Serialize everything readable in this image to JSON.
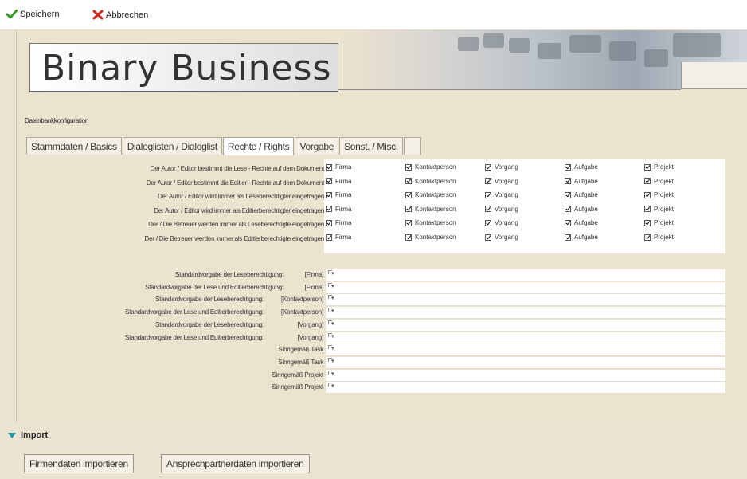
{
  "toolbar": {
    "save_label": "Speichern",
    "cancel_label": "Abbrechen"
  },
  "branding": {
    "logo_text": "Binary Business"
  },
  "section_label": "Datenbankkonfiguration",
  "tabs": [
    {
      "label": "Stammdaten / Basics",
      "active": false
    },
    {
      "label": "Dialoglisten / Dialoglist",
      "active": false
    },
    {
      "label": "Rechte / Rights",
      "active": true
    },
    {
      "label": "Vorgabe",
      "active": false
    },
    {
      "label": "Sonst. / Misc.",
      "active": false
    },
    {
      "label": "",
      "active": false
    }
  ],
  "rights_rows": [
    {
      "label": "Der Autor / Editor bestimmt die Lese - Rechte auf dem Dokument",
      "checks": [
        "Firma",
        "Kontaktperson",
        "Vorgang",
        "Aufgabe",
        "Projekt"
      ]
    },
    {
      "label": "Der Autor / Editor bestimmt die Editier - Rechte auf dem Dokument",
      "checks": [
        "Firma",
        "Kontaktperson",
        "Vorgang",
        "Aufgabe",
        "Projekt"
      ]
    },
    {
      "label": "Der Autor / Editor wird immer als Leseberechtigter eingetragen",
      "checks": [
        "Firma",
        "Kontaktperson",
        "Vorgang",
        "Aufgabe",
        "Projekt"
      ]
    },
    {
      "label": "Der Autor / Editor wird immer als Editierberechtigter eingetragen",
      "checks": [
        "Firma",
        "Kontaktperson",
        "Vorgang",
        "Aufgabe",
        "Projekt"
      ]
    },
    {
      "label": "Der / Die Betreuer werden immer als Leseberechtigte eingetragen",
      "checks": [
        "Firma",
        "Kontaktperson",
        "Vorgang",
        "Aufgabe",
        "Projekt"
      ]
    },
    {
      "label": "Der / Die Betreuer werden immer als Editierberechtigte eingetragen",
      "checks": [
        "Firma",
        "Kontaktperson",
        "Vorgang",
        "Aufgabe",
        "Projekt"
      ]
    }
  ],
  "default_rows": [
    {
      "label": "Standardvorgabe der Leseberechtigung:",
      "suffix": "[Firma]"
    },
    {
      "label": "Standardvorgabe der Lese und Editierberechtigung:",
      "suffix": "[Firma]"
    },
    {
      "label": "Standardvorgabe der Leseberechtigung:",
      "suffix": "[Kontaktperson]"
    },
    {
      "label": "Standardvorgabe der Lese und Editierberechtigung:",
      "suffix": "[Kontaktperson]"
    },
    {
      "label": "Standardvorgabe der Leseberechtigung:",
      "suffix": "[Vorgang]"
    },
    {
      "label": "Standardvorgabe der Lese und Editierberechtigung:",
      "suffix": "[Vorgang]"
    },
    {
      "label": "Sinngemäß Task",
      "suffix": ""
    },
    {
      "label": "Sinngemäß Task",
      "suffix": ""
    },
    {
      "label": "Sinngemäß Projekt",
      "suffix": ""
    },
    {
      "label": "Sinngemäß Projekt",
      "suffix": ""
    }
  ],
  "import": {
    "title": "Import",
    "buttons": [
      "Firmendaten importieren",
      "Ansprechpartnerdaten importieren"
    ]
  },
  "colors": {
    "accent_green": "#3a9a2a",
    "cancel_red": "#cc2a1a",
    "import_arrow": "#1d9aa8"
  }
}
